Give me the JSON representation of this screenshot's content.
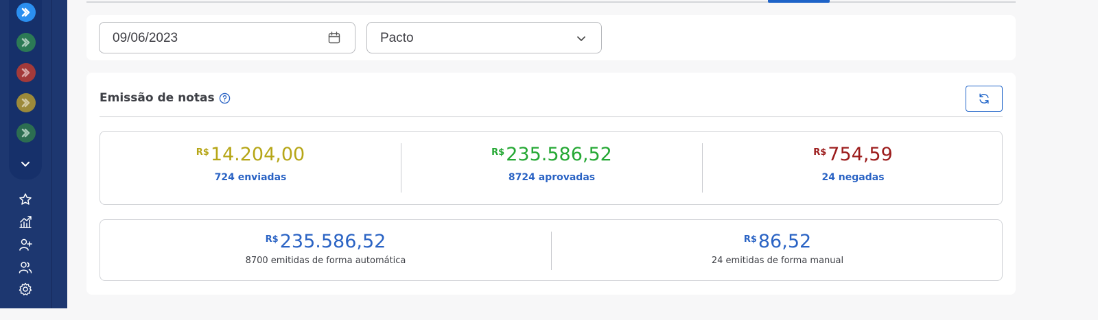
{
  "colors": {
    "sidebar": "#1d3770",
    "accent": "#1e63c8",
    "yellow": "#b6a617",
    "green": "#25a834",
    "red": "#9c1c1c",
    "blue": "#2a63c4"
  },
  "sidebar": {
    "apps": [
      {
        "icon": "pacto-app-icon",
        "color": "#2b8ff0"
      },
      {
        "icon": "pacto-app-icon",
        "color": "#2c7a55"
      },
      {
        "icon": "pacto-app-icon",
        "color": "#a33a3a"
      },
      {
        "icon": "pacto-app-icon",
        "color": "#9c8a3a"
      },
      {
        "icon": "pacto-app-icon",
        "color": "#2c6e51"
      }
    ],
    "nav_icons": [
      "star-icon",
      "chart-growth-icon",
      "user-add-icon",
      "users-icon",
      "gear-icon"
    ]
  },
  "filters": {
    "date_value": "09/06/2023",
    "company_value": "Pacto"
  },
  "card": {
    "title": "Emissão de notas"
  },
  "summary": [
    {
      "currency": "R$",
      "amount": "14.204,00",
      "label": "724 enviadas",
      "color": "#b6a617"
    },
    {
      "currency": "R$",
      "amount": "235.586,52",
      "label": "8724 aprovadas",
      "color": "#25a834"
    },
    {
      "currency": "R$",
      "amount": "754,59",
      "label": "24 negadas",
      "color": "#9c1c1c"
    }
  ],
  "emission": [
    {
      "currency": "R$",
      "amount": "235.586,52",
      "label": "8700 emitidas de forma automática"
    },
    {
      "currency": "R$",
      "amount": "86,52",
      "label": "24 emitidas de forma manual"
    }
  ]
}
